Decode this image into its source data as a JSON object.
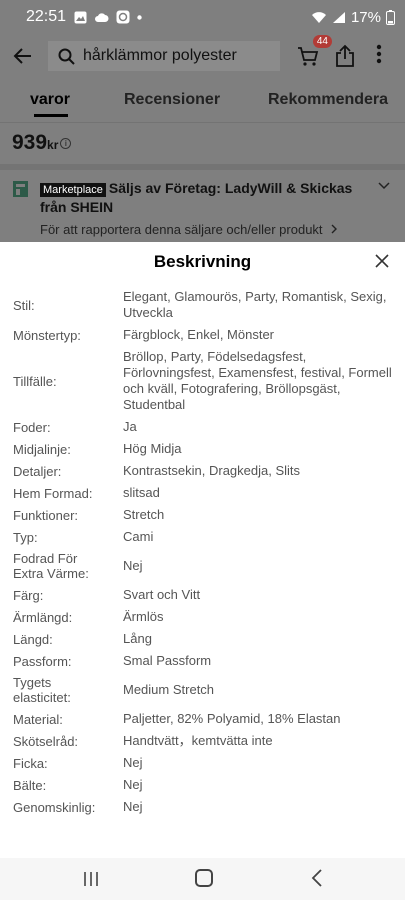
{
  "status_bar": {
    "time": "22:51",
    "battery": "17%"
  },
  "search": {
    "query": "hårklämmor polyester"
  },
  "cart": {
    "count": "44"
  },
  "tabs": [
    "varor",
    "Recensioner",
    "Rekommendera"
  ],
  "price": {
    "value": "939",
    "currency": "kr"
  },
  "seller": {
    "badge": "Marketplace",
    "text": "Säljs av Företag: LadyWill & Skickas från SHEIN",
    "report": "För att rapportera denna säljare och/eller produkt"
  },
  "sheet": {
    "title": "Beskrivning",
    "rows": [
      {
        "label": "Stil:",
        "value": "Elegant, Glamourös, Party, Romantisk, Sexig, Utveckla"
      },
      {
        "label": "Mönstertyp:",
        "value": "Färgblock, Enkel, Mönster"
      },
      {
        "label": "Tillfälle:",
        "value": "Bröllop, Party, Födelsedagsfest, Förlovningsfest, Examensfest, festival, Formell och kväll, Fotografering, Bröllopsgäst, Studentbal"
      },
      {
        "label": "Foder:",
        "value": "Ja"
      },
      {
        "label": "Midjalinje:",
        "value": "Hög Midja"
      },
      {
        "label": "Detaljer:",
        "value": "Kontrastsekin, Dragkedja, Slits"
      },
      {
        "label": "Hem Formad:",
        "value": "slitsad"
      },
      {
        "label": "Funktioner:",
        "value": "Stretch"
      },
      {
        "label": "Typ:",
        "value": "Cami"
      },
      {
        "label": "Fodrad För Extra Värme:",
        "value": "Nej"
      },
      {
        "label": "Färg:",
        "value": "Svart och Vitt"
      },
      {
        "label": "Ärmlängd:",
        "value": "Ärmlös"
      },
      {
        "label": "Längd:",
        "value": "Lång"
      },
      {
        "label": "Passform:",
        "value": "Smal Passform"
      },
      {
        "label": "Tygets elasticitet:",
        "value": "Medium Stretch"
      },
      {
        "label": "Material:",
        "value": "Paljetter, 82% Polyamid, 18% Elastan"
      },
      {
        "label": "Skötselråd:",
        "value": "Handtvätt，kemtvätta inte"
      },
      {
        "label": "Ficka:",
        "value": "Nej"
      },
      {
        "label": "Bälte:",
        "value": "Nej"
      },
      {
        "label": "Genomskinlig:",
        "value": "Nej"
      }
    ]
  }
}
